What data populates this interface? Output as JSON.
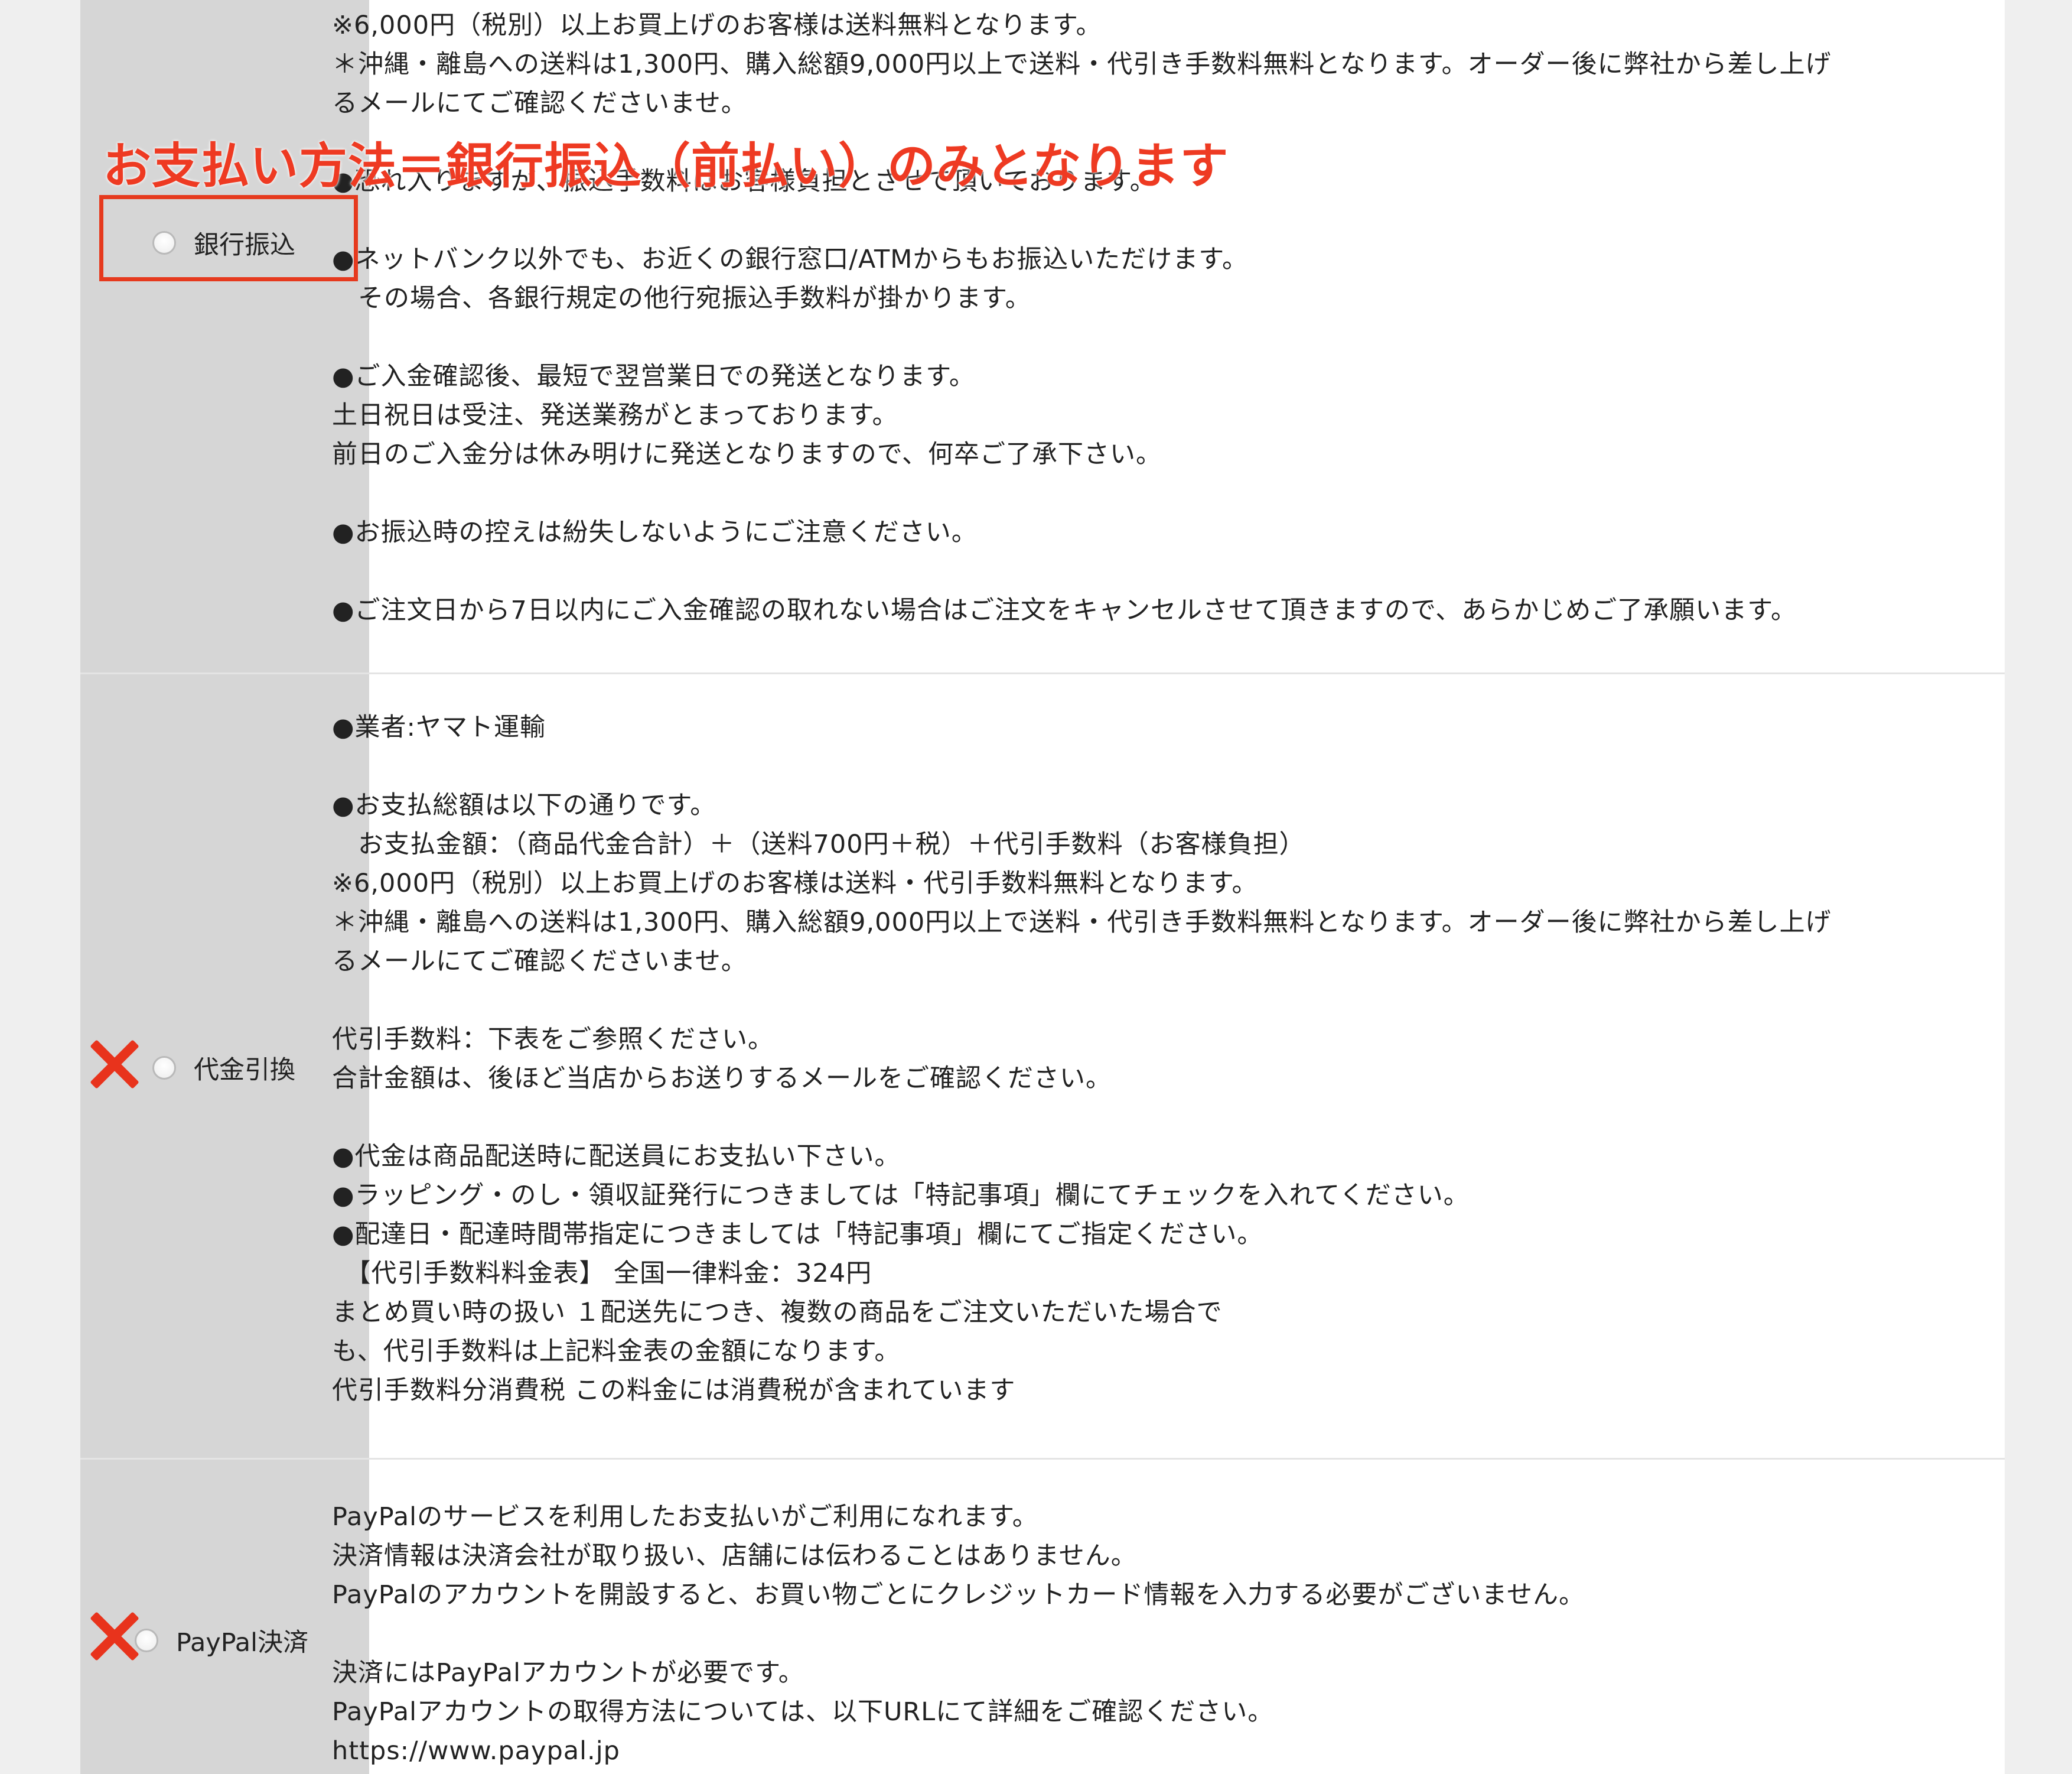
{
  "annotation": {
    "text": "お支払い方法＝銀行振込（前払い）のみとなります",
    "color": "#ee3a22"
  },
  "options": {
    "bank": {
      "label": "銀行振込",
      "marked": "highlighted"
    },
    "cod": {
      "label": "代金引換",
      "marked": "x-mark"
    },
    "paypal": {
      "label": "PayPal決済",
      "marked": "x-mark"
    }
  },
  "sections": {
    "bank_lines": [
      "※6,000円（税別）以上お買上げのお客様は送料無料となります。",
      "＊沖縄・離島への送料は1,300円、購入総額9,000円以上で送料・代引き手数料無料となります。オーダー後に弊社から差し上げ",
      "るメールにてご確認くださいませ。",
      "",
      "●恐れ入りますが、振込手数料はお客様負担とさせて頂いております。",
      "",
      "●ネットバンク以外でも、お近くの銀行窓口/ATMからもお振込いただけます。",
      "　その場合、各銀行規定の他行宛振込手数料が掛かります。",
      "",
      "●ご入金確認後、最短で翌営業日での発送となります。",
      "土日祝日は受注、発送業務がとまっております。",
      "前日のご入金分は休み明けに発送となりますので、何卒ご了承下さい。",
      "",
      "●お振込時の控えは紛失しないようにご注意ください。",
      "",
      "●ご注文日から7日以内にご入金確認の取れない場合はご注文をキャンセルさせて頂きますので、あらかじめご了承願います。"
    ],
    "cod_lines": [
      "●業者:ヤマト運輸",
      "",
      "●お支払総額は以下の通りです。",
      "　お支払金額：（商品代金合計）＋（送料700円＋税）＋代引手数料（お客様負担）",
      "※6,000円（税別）以上お買上げのお客様は送料・代引手数料無料となります。",
      "＊沖縄・離島への送料は1,300円、購入総額9,000円以上で送料・代引き手数料無料となります。オーダー後に弊社から差し上げ",
      "るメールにてご確認くださいませ。",
      "",
      "代引手数料：下表をご参照ください。",
      "合計金額は、後ほど当店からお送りするメールをご確認ください。",
      "",
      "●代金は商品配送時に配送員にお支払い下さい。",
      "●ラッピング・のし・領収証発行につきましては「特記事項」欄にてチェックを入れてください。",
      "●配達日・配達時間帯指定につきましては「特記事項」欄にてご指定ください。",
      "　【代引手数料料金表】 全国一律料金：324円",
      "まとめ買い時の扱い １配送先につき、複数の商品をご注文いただいた場合で",
      "も、代引手数料は上記料金表の金額になります。",
      "代引手数料分消費税 この料金には消費税が含まれています"
    ],
    "paypal_lines": [
      "PayPalのサービスを利用したお支払いがご利用になれます。",
      "決済情報は決済会社が取り扱い、店舗には伝わることはありません。",
      "PayPalのアカウントを開設すると、お買い物ごとにクレジットカード情報を入力する必要がございません。",
      "",
      "決済にはPayPalアカウントが必要です。",
      "PayPalアカウントの取得方法については、以下URLにて詳細をご確認ください。",
      "https://www.paypal.jp"
    ]
  }
}
